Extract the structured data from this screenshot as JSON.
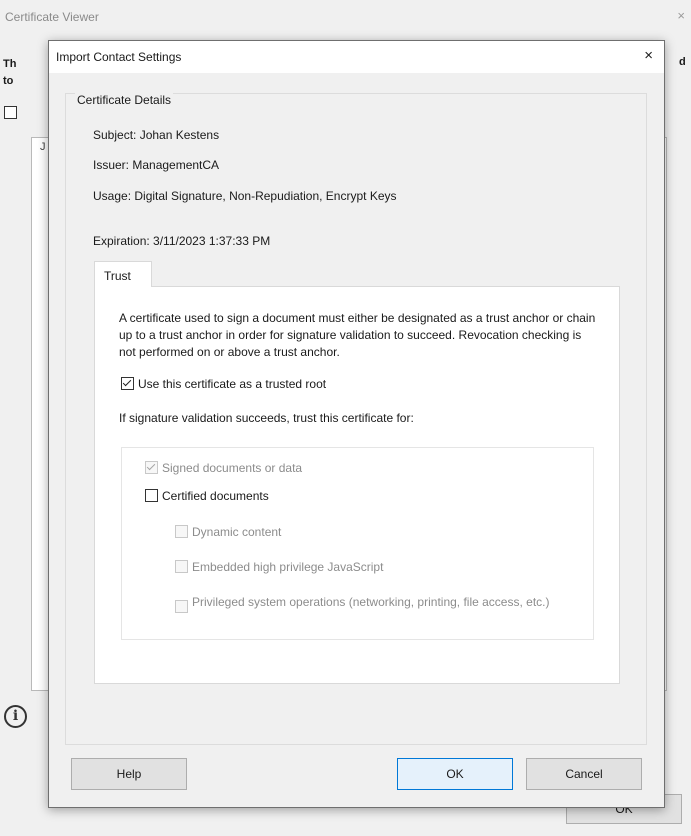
{
  "background_window": {
    "title": "Certificate Viewer",
    "close_glyph": "×",
    "bold_left": "Th\nto",
    "bold_right": "d",
    "panel_text": "J",
    "info_glyph": "i",
    "ok_label": "OK"
  },
  "dialog": {
    "title": "Import Contact Settings",
    "close_glyph": "×",
    "group_label": "Certificate Details",
    "subject": "Subject:   Johan Kestens",
    "issuer": "Issuer:   ManagementCA",
    "usage": "Usage:   Digital Signature, Non-Repudiation, Encrypt Keys",
    "expiration": "Expiration:   3/11/2023 1:37:33 PM",
    "tab_label": "Trust",
    "trust_paragraph": "A certificate used to sign a document must either be designated as a trust anchor or chain up to a trust anchor in order for signature validation to succeed.  Revocation checking is not performed on or above a trust anchor.",
    "trusted_root_label": "Use this certificate as a trusted root",
    "trust_for_label": "If signature validation succeeds, trust this certificate for:",
    "options": {
      "signed_docs": "Signed documents or data",
      "certified_docs": "Certified documents",
      "dynamic_content": "Dynamic content",
      "embedded_js": "Embedded high privilege JavaScript",
      "privileged_ops": "Privileged system operations (networking, printing, file access, etc.)"
    },
    "buttons": {
      "help": "Help",
      "ok": "OK",
      "cancel": "Cancel"
    }
  }
}
